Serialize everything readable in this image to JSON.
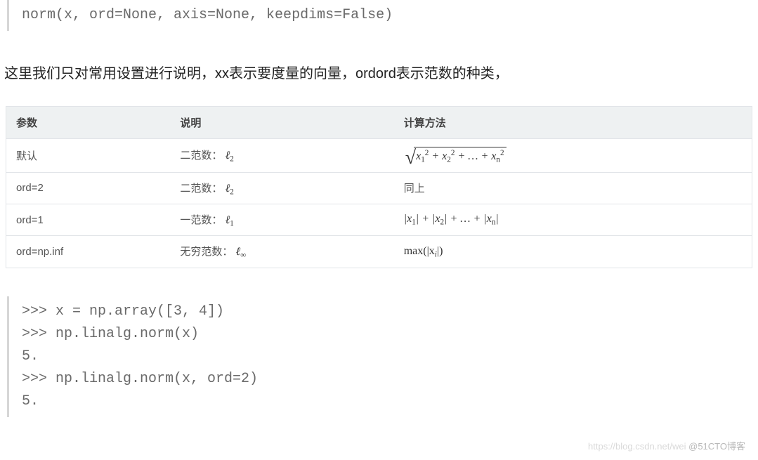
{
  "signature": "norm(x, ord=None, axis=None, keepdims=False)",
  "paragraph": "这里我们只对常用设置进行说明，xx表示要度量的向量，ordord表示范数的种类，",
  "table": {
    "headers": {
      "param": "参数",
      "desc": "说明",
      "calc": "计算方法"
    },
    "rows": [
      {
        "param": "默认",
        "desc_plain": "二范数：",
        "desc_math": "ℓ₂",
        "calc_key": "sqrt_sumsq"
      },
      {
        "param": "ord=2",
        "desc_plain": "二范数：",
        "desc_math": "ℓ₂",
        "calc_key": "same_as_above",
        "calc_plain": "同上"
      },
      {
        "param": "ord=1",
        "desc_plain": "一范数：",
        "desc_math": "ℓ₁",
        "calc_key": "sum_abs"
      },
      {
        "param": "ord=np.inf",
        "desc_plain": "无穷范数：",
        "desc_math": "ℓ∞",
        "calc_key": "max_abs"
      }
    ]
  },
  "session": {
    "lines": [
      ">>> x = np.array([3, 4])",
      ">>> np.linalg.norm(x)",
      "5.",
      ">>> np.linalg.norm(x, ord=2)",
      "5."
    ]
  },
  "watermark": {
    "left": "https://blog.csdn.net/wei",
    "right": "@51CTO博客"
  }
}
